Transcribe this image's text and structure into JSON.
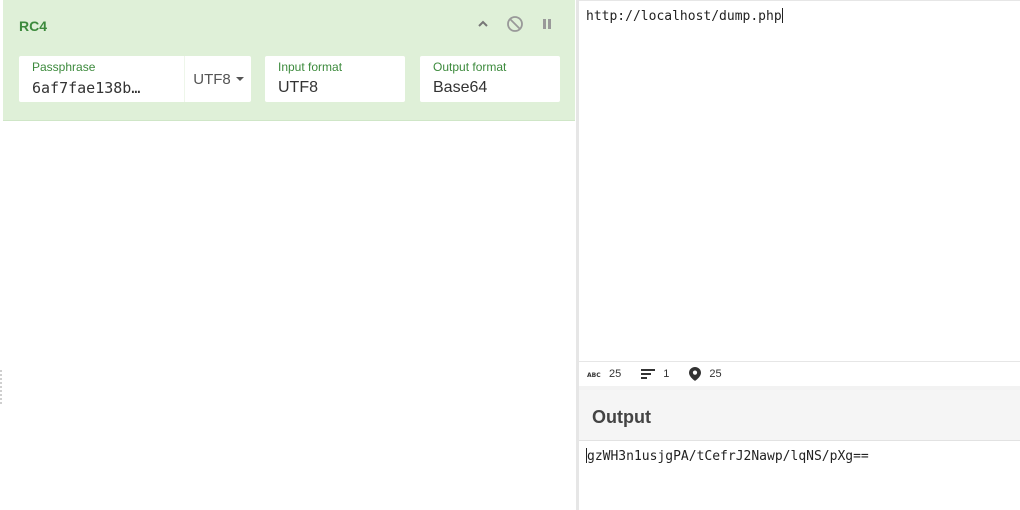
{
  "operation": {
    "title": "RC4",
    "icons": [
      "chevron-up-icon",
      "disable-icon",
      "pause-icon"
    ],
    "passphrase": {
      "label": "Passphrase",
      "value": "6af7fae138b…",
      "encoding": "UTF8"
    },
    "input_format": {
      "label": "Input format",
      "value": "UTF8"
    },
    "output_format": {
      "label": "Output format",
      "value": "Base64"
    }
  },
  "input": {
    "text": "http://localhost/dump.php"
  },
  "status": {
    "length_icon": "abc-icon",
    "length": "25",
    "lines_icon": "lines-icon",
    "lines": "1",
    "position_icon": "map-pin-icon",
    "position": "25"
  },
  "output": {
    "title": "Output",
    "text": "gzWH3n1usjgPA/tCefrJ2Nawp/lqNS/pXg=="
  },
  "colors": {
    "card_bg": "#dff0d8",
    "label_green": "#3c8a3c"
  }
}
